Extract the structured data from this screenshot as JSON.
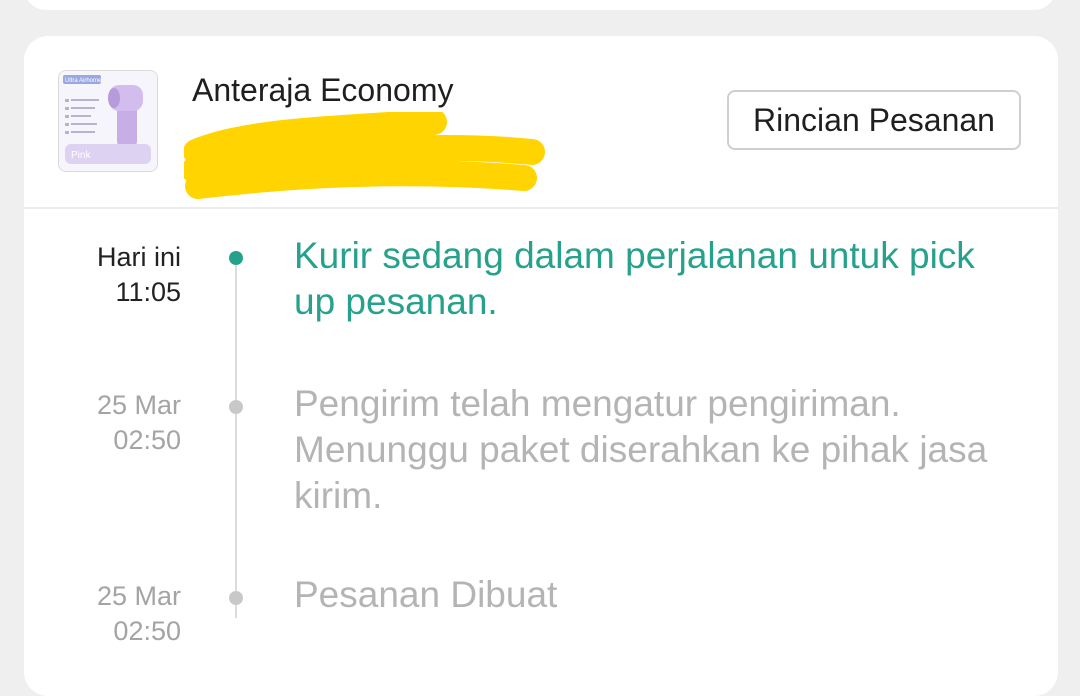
{
  "order": {
    "courier_name": "Anteraja Economy",
    "details_button": "Rincian Pesanan",
    "product_thumb": {
      "banner_text": "Ultra Airhome",
      "variant_label": "Pink"
    }
  },
  "timeline": [
    {
      "date": "Hari ini",
      "time": "11:05",
      "message": "Kurir sedang dalam perjalanan untuk pick up pesanan.",
      "active": true
    },
    {
      "date": "25 Mar",
      "time": "02:50",
      "message": "Pengirim telah mengatur pengiriman. Menunggu paket diserahkan ke pihak jasa kirim.",
      "active": false
    },
    {
      "date": "25 Mar",
      "time": "02:50",
      "message": "Pesanan Dibuat",
      "active": false
    }
  ],
  "colors": {
    "accent": "#26a28c",
    "inactive_text": "#b4b4b4",
    "redaction": "#ffd400"
  }
}
